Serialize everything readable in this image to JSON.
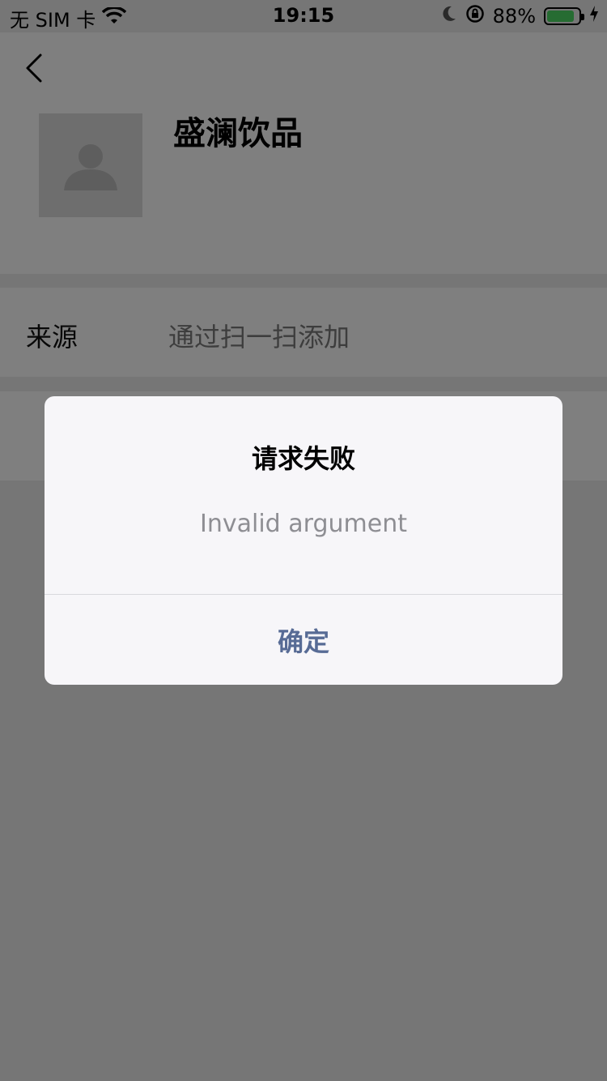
{
  "status_bar": {
    "carrier": "无 SIM 卡",
    "time": "19:15",
    "battery_percent": "88%",
    "battery_level": 0.88,
    "icons": [
      "wifi-icon",
      "moon-icon",
      "rotation-lock-icon",
      "battery-icon",
      "charging-icon"
    ]
  },
  "header": {
    "back_icon": "chevron-left-icon",
    "avatar_icon": "person-icon",
    "name": "盛澜饮品"
  },
  "info": {
    "source_label": "来源",
    "source_value": "通过扫一扫添加"
  },
  "dialog": {
    "title": "请求失败",
    "message": "Invalid argument",
    "confirm_label": "确定"
  },
  "colors": {
    "background": "#ededed",
    "card": "#ffffff",
    "dialog_bg": "#f7f6f9",
    "link": "#576b95",
    "battery": "#4cd964"
  }
}
